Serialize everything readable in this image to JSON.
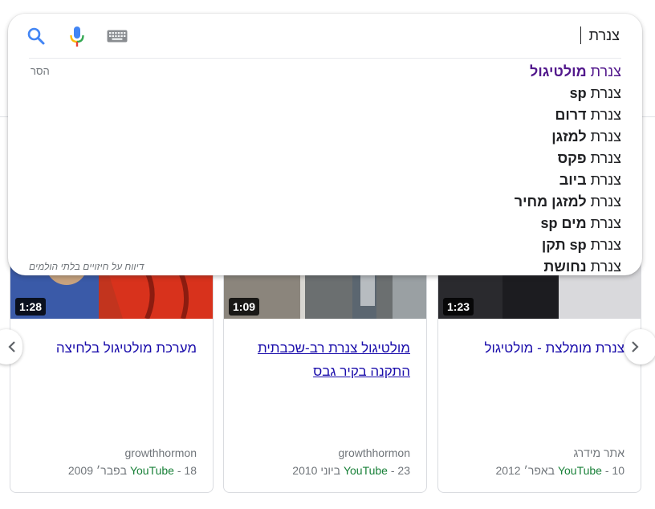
{
  "search": {
    "query": "צנרת",
    "remove_label": "הסר",
    "report_label": "דיווח על חיזויים בלתי הולמים",
    "suggestions": [
      {
        "base": "צנרת",
        "completion": "מולטיגול"
      },
      {
        "base": "צנרת",
        "completion": "sp"
      },
      {
        "base": "צנרת",
        "completion": "דרום"
      },
      {
        "base": "צנרת",
        "completion": "למזגן"
      },
      {
        "base": "צנרת",
        "completion": "פקס"
      },
      {
        "base": "צנרת",
        "completion": "ביוב"
      },
      {
        "base": "צנרת",
        "completion": "למזגן מחיר"
      },
      {
        "base": "צנרת",
        "completion": "מים sp"
      },
      {
        "base": "צנרת",
        "completion": "sp תקן"
      },
      {
        "base": "צנרת",
        "completion": "נחושת"
      }
    ],
    "icons": {
      "search": "search-icon",
      "voice": "microphone-icon",
      "keyboard": "keyboard-icon"
    }
  },
  "videos": [
    {
      "title": "מערכת מולטיגול בלחיצה",
      "channel": "growthhormon",
      "source": "YouTube",
      "date": "18 בפבר׳ 2009",
      "duration": "1:28"
    },
    {
      "title": "מולטיגול צנרת רב-שכבתית התקנה בקיר גבס",
      "channel": "growthhormon",
      "source": "YouTube",
      "date": "23 ביוני 2010",
      "duration": "1:09"
    },
    {
      "title": "צנרת מומלצת - מולטיגול",
      "channel": "אתר מידרג",
      "source": "YouTube",
      "date": "10 באפר׳ 2012",
      "duration": "1:23"
    }
  ],
  "colors": {
    "link": "#1a0dab",
    "visited": "#52188c",
    "source": "#188038",
    "muted": "#70757a"
  }
}
